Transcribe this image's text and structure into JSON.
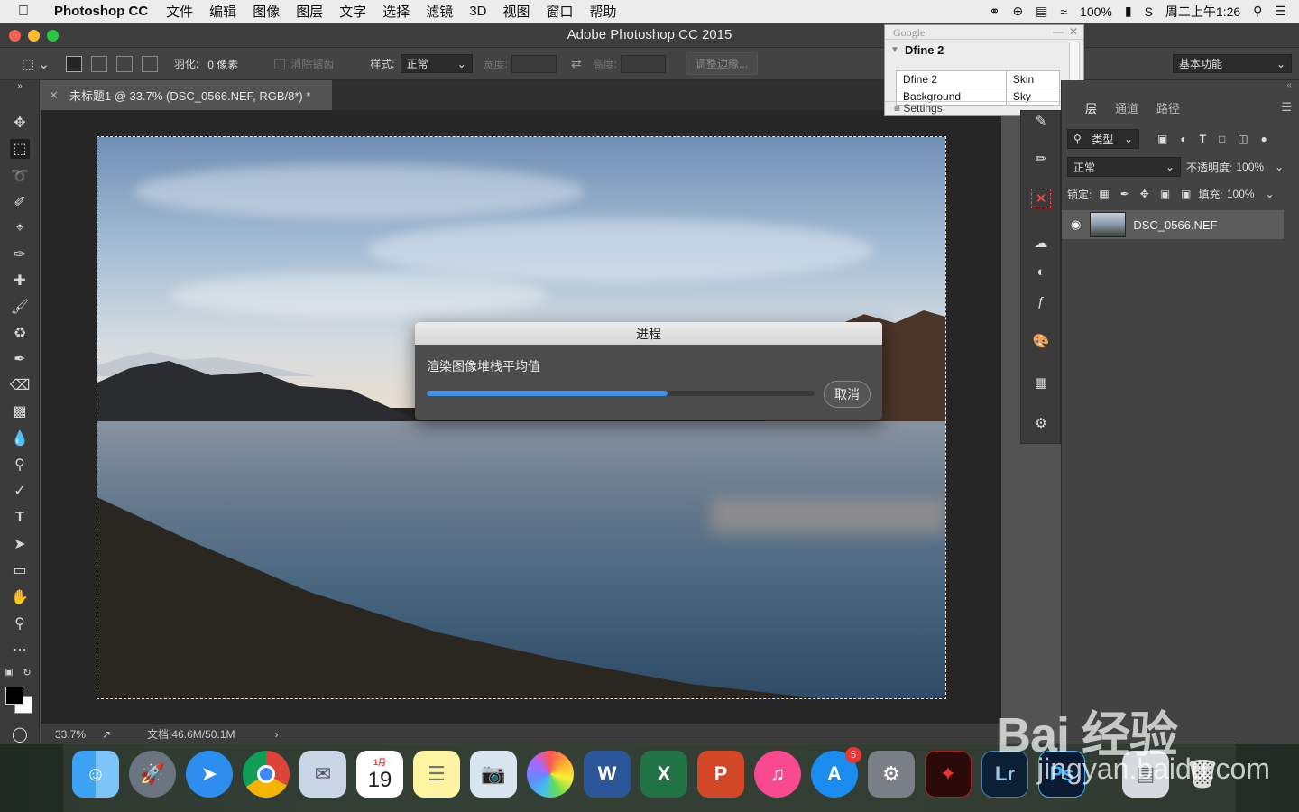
{
  "menubar": {
    "app_name": "Photoshop CC",
    "items": [
      "文件",
      "编辑",
      "图像",
      "图层",
      "文字",
      "选择",
      "滤镜",
      "3D",
      "视图",
      "窗口",
      "帮助"
    ],
    "battery": "100%",
    "clock": "周二上午1:26"
  },
  "window": {
    "title": "Adobe Photoshop CC 2015"
  },
  "options": {
    "feather_label": "羽化:",
    "feather_value": "0 像素",
    "antialias": "消除锯齿",
    "style_label": "样式:",
    "style_value": "正常",
    "width_label": "宽度:",
    "height_label": "高度:",
    "refine_edge": "调整边缘...",
    "workspace": "基本功能"
  },
  "document_tab": {
    "title": "未标题1 @ 33.7% (DSC_0566.NEF, RGB/8*) *"
  },
  "status": {
    "zoom": "33.7%",
    "doc_info": "文档:46.6M/50.1M"
  },
  "progress_dialog": {
    "title": "进程",
    "message": "渲染图像堆栈平均值",
    "progress": 0.62,
    "cancel_label": "取消"
  },
  "dfine_panel": {
    "brand": "Google",
    "title": "Dfine 2",
    "rows": [
      [
        "Dfine 2",
        "Skin"
      ],
      [
        "Background",
        "Sky"
      ]
    ],
    "settings": "Settings"
  },
  "layers_panel": {
    "tabs": [
      "层",
      "通道",
      "路径"
    ],
    "filter_kind": "类型",
    "blend_mode": "正常",
    "opacity_label": "不透明度:",
    "opacity_value": "100%",
    "lock_label": "锁定:",
    "fill_label": "填充:",
    "fill_value": "100%",
    "layer_name": "DSC_0566.NEF"
  },
  "dock": {
    "calendar_month": "1月",
    "calendar_day": "19",
    "appstore_badge": "5"
  },
  "watermark": {
    "logo": "Bai 经验",
    "url": "jingyan.baidu.com"
  },
  "colors": {
    "progress": "#3d8fe8",
    "panel_bg": "#434343",
    "canvas_bg": "#262626"
  }
}
